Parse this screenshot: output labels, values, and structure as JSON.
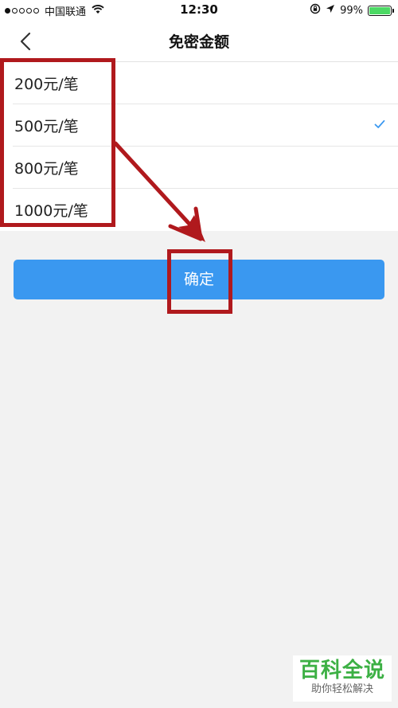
{
  "status_bar": {
    "carrier": "中国联通",
    "time": "12:30",
    "battery_text": "99%",
    "battery_level": 0.99,
    "signal_dots_filled": 1,
    "signal_dots_total": 5
  },
  "nav": {
    "title": "免密金额",
    "back_icon": "chevron-left-icon"
  },
  "options": [
    {
      "label": "200元/笔",
      "selected": false
    },
    {
      "label": "500元/笔",
      "selected": true
    },
    {
      "label": "800元/笔",
      "selected": false
    },
    {
      "label": "1000元/笔",
      "selected": false
    }
  ],
  "confirm": {
    "label": "确定"
  },
  "watermark": {
    "title": "百科全说",
    "subtitle": "助你轻松解决"
  },
  "colors": {
    "accent": "#3a98f0",
    "check": "#3a98f0",
    "annotation": "#b0191d",
    "battery": "#4cd964",
    "watermark": "#3cb044"
  }
}
